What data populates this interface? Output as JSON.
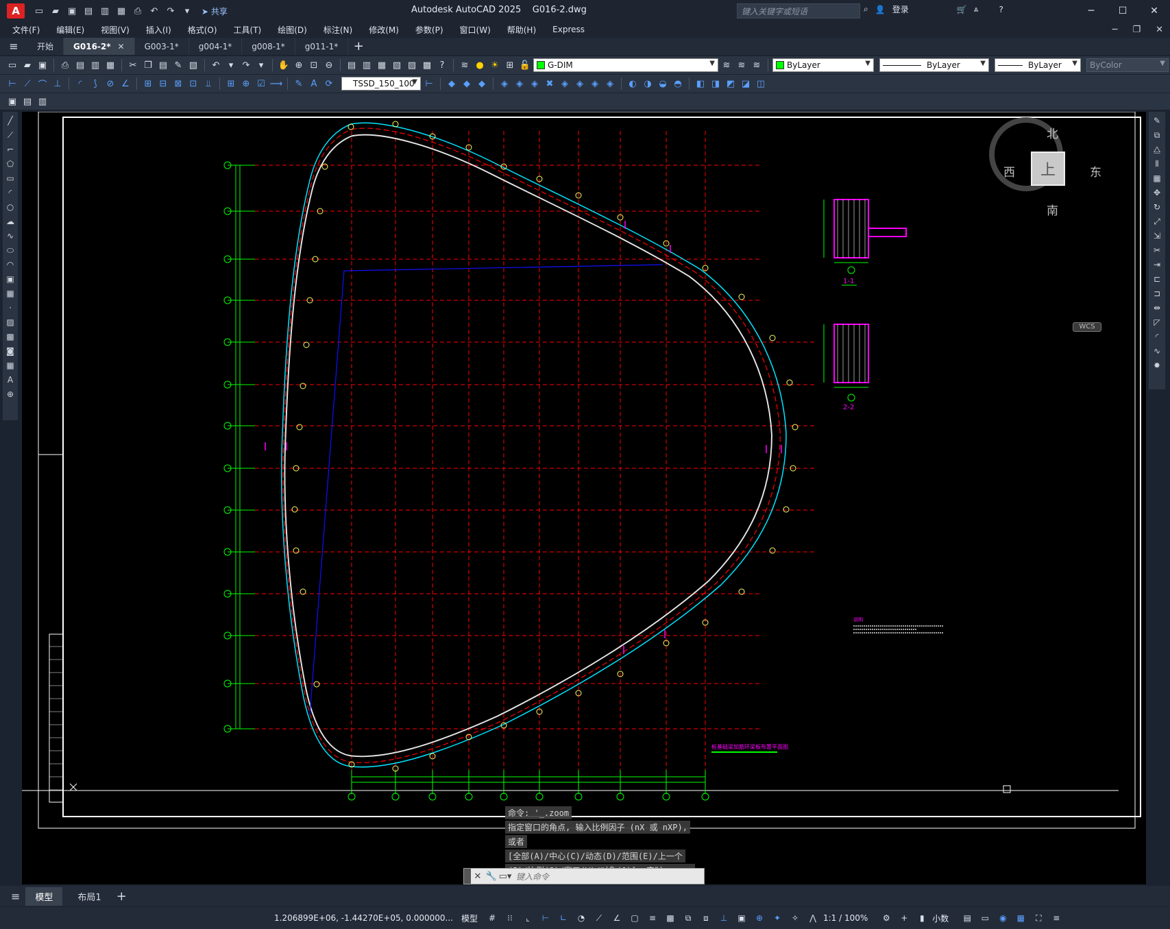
{
  "titlebar": {
    "app_logo": "A",
    "share": "共享",
    "title": "Autodesk AutoCAD 2025    G016-2.dwg",
    "search_placeholder": "键入关键字或短语",
    "login": "登录"
  },
  "menu": [
    "文件(F)",
    "编辑(E)",
    "视图(V)",
    "插入(I)",
    "格式(O)",
    "工具(T)",
    "绘图(D)",
    "标注(N)",
    "修改(M)",
    "参数(P)",
    "窗口(W)",
    "帮助(H)",
    "Express"
  ],
  "tabs": [
    {
      "label": "开始",
      "active": false
    },
    {
      "label": "G016-2*",
      "active": true
    },
    {
      "label": "G003-1*",
      "active": false
    },
    {
      "label": "g004-1*",
      "active": false
    },
    {
      "label": "g008-1*",
      "active": false
    },
    {
      "label": "g011-1*",
      "active": false
    }
  ],
  "tab_close": "✕",
  "properties": {
    "layer": "G-DIM",
    "color": "ByLayer",
    "linetype": "ByLayer",
    "lineweight": "ByLayer",
    "plotstyle": "ByColor",
    "dimstyle": "TSSD_150_100"
  },
  "viewcube": {
    "north": "北",
    "south": "南",
    "west": "西",
    "east": "东",
    "face": "上",
    "wcs": "WCS"
  },
  "drawing": {
    "section_1": "1-1",
    "section_2": "2-2",
    "cut_mark_1": "1",
    "cut_mark_2": "2",
    "notes_title": "说明",
    "plan_title": "桩基础梁加筋环梁板布置平面图"
  },
  "command": {
    "history": [
      "命令: '_.zoom",
      "指定窗口的角点, 输入比例因子 (nX 或 nXP),",
      "或者",
      "[全部(A)/中心(C)/动态(D)/范围(E)/上一个",
      "(P)/比例(S)/窗口(W)/对象(O)] <实时>:  _e"
    ],
    "placeholder": "键入命令"
  },
  "layout_tabs": [
    {
      "label": "模型",
      "active": true
    },
    {
      "label": "布局1",
      "active": false
    }
  ],
  "status": {
    "coords": "1.206899E+06, -1.44270E+05, 0.000000...",
    "model": "模型",
    "scale": "1:1 / 100%",
    "units": "小数"
  },
  "colors": {
    "canvas": "#000000",
    "grid_red": "#ff0000",
    "axis_green": "#00ff00",
    "outer_cyan": "#00e5ff",
    "magenta": "#ff00ff",
    "blue_line": "#1010ff"
  }
}
